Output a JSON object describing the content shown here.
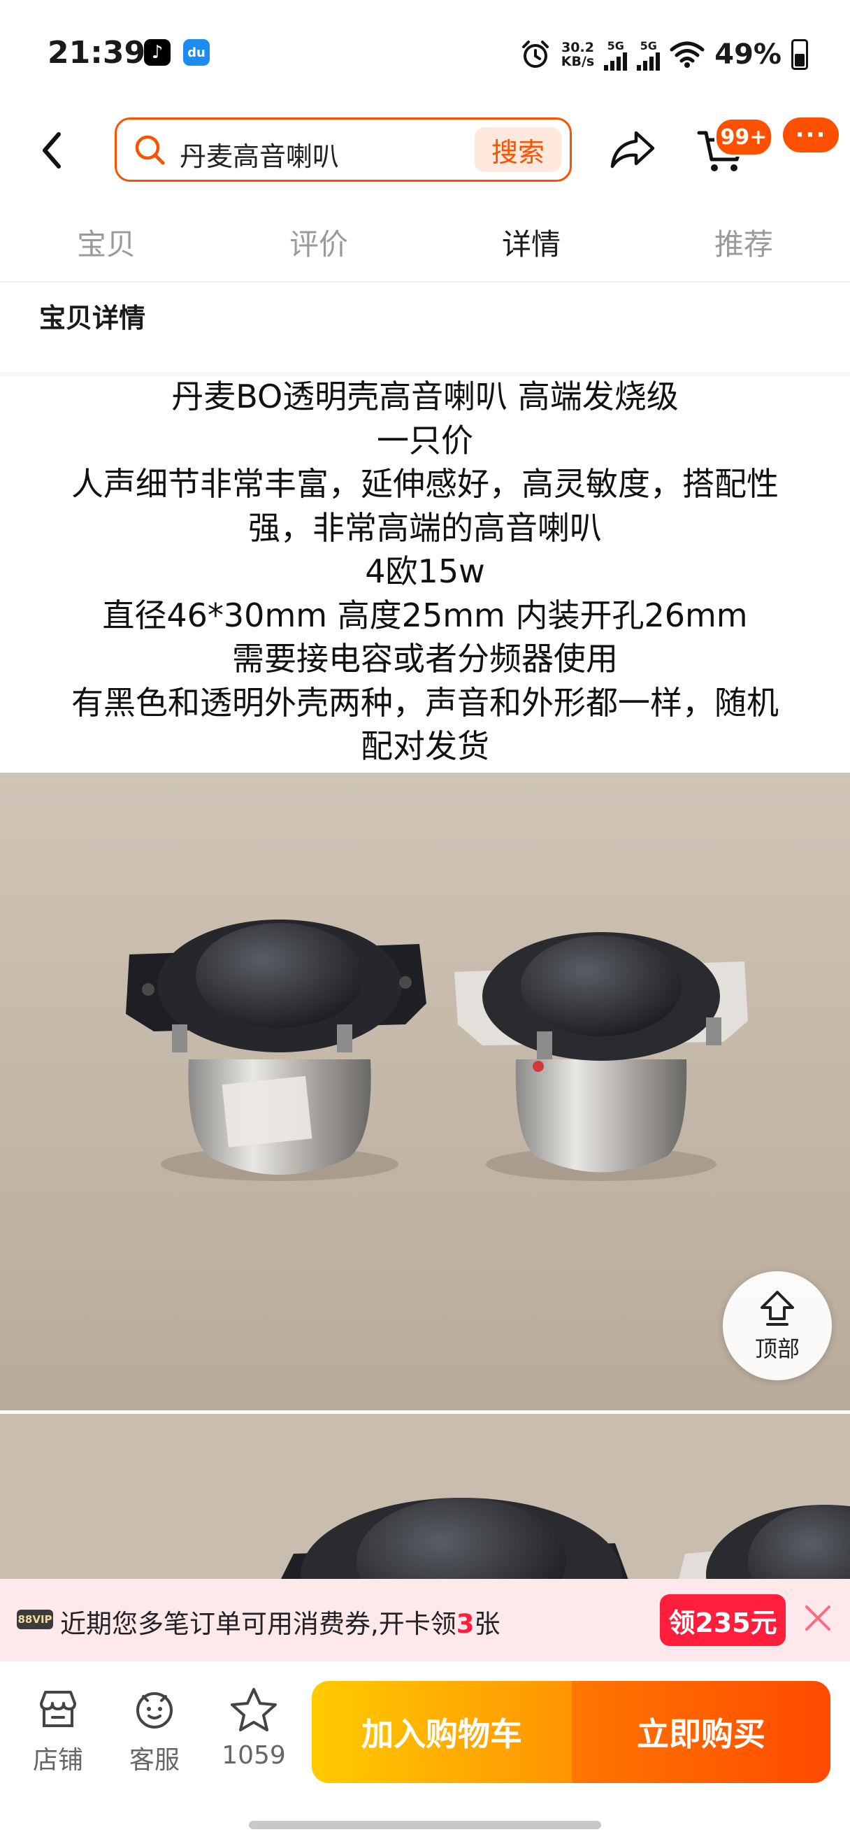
{
  "status_bar": {
    "time": "21:39",
    "net_speed_value": "30.2",
    "net_speed_unit": "KB/s",
    "sim1": "5G",
    "sim2": "5G",
    "battery": "49%"
  },
  "header": {
    "search_query": "丹麦高音喇叭",
    "search_button": "搜索",
    "cart_badge": "99+",
    "more_label": "···",
    "icons": [
      "back-arrow-icon",
      "search-icon",
      "share-icon",
      "cart-icon"
    ]
  },
  "tabs": [
    {
      "label": "宝贝",
      "active": false
    },
    {
      "label": "评价",
      "active": false
    },
    {
      "label": "详情",
      "active": true
    },
    {
      "label": "推荐",
      "active": false
    }
  ],
  "section_title": "宝贝详情",
  "description": [
    "丹麦BO透明壳高音喇叭 高端发烧级",
    "一只价",
    "人声细节非常丰富，延伸感好，高灵敏度，搭配性",
    "强，非常高端的高音喇叭",
    "4欧15w",
    "直径46*30mm 高度25mm 内装开孔26mm",
    "需要接电容或者分频器使用",
    "有黑色和透明外壳两种，声音和外形都一样，随机",
    "配对发货"
  ],
  "back_to_top": "顶部",
  "promo": {
    "badge": "88VIP",
    "text_before": "近期您多笔订单可用消费券,开卡领",
    "count": "3",
    "text_after": "张",
    "claim_button": "领235元"
  },
  "bottom_bar": {
    "store": "店铺",
    "service": "客服",
    "favorites": "1059",
    "add_to_cart": "加入购物车",
    "buy_now": "立即购买"
  },
  "colors": {
    "accent": "#ff5000",
    "promo_red": "#ff1e3c",
    "cart_gradient_start": "#ffcb00",
    "buy_gradient_end": "#ff4a00"
  }
}
